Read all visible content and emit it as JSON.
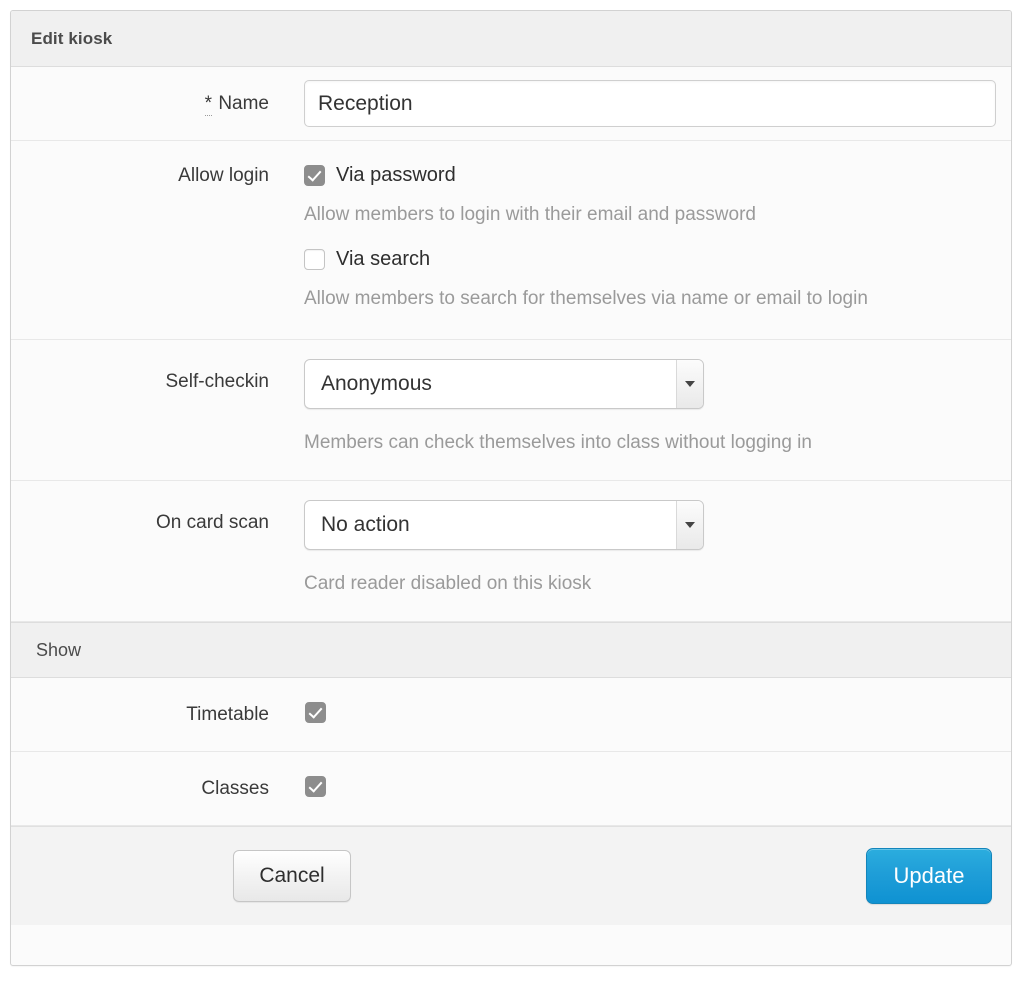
{
  "panel": {
    "title": "Edit kiosk"
  },
  "fields": {
    "name": {
      "required_marker": "*",
      "label": "Name",
      "value": "Reception",
      "placeholder": ""
    },
    "allow_login": {
      "label": "Allow login",
      "options": [
        {
          "label": "Via password",
          "checked": true,
          "help": "Allow members to login with their email and password"
        },
        {
          "label": "Via search",
          "checked": false,
          "help": "Allow members to search for themselves via name or email to login"
        }
      ]
    },
    "self_checkin": {
      "label": "Self-checkin",
      "value": "Anonymous",
      "help": "Members can check themselves into class without logging in"
    },
    "on_card_scan": {
      "label": "On card scan",
      "value": "No action",
      "help": "Card reader disabled on this kiosk"
    }
  },
  "show_section": {
    "title": "Show",
    "rows": [
      {
        "label": "Timetable",
        "checked": true
      },
      {
        "label": "Classes",
        "checked": true
      }
    ]
  },
  "footer": {
    "cancel_label": "Cancel",
    "update_label": "Update"
  },
  "colors": {
    "accent": "#1f9ed8",
    "panel_header_bg": "#f0f0f0",
    "checkbox_checked": "#8d8d8d",
    "help_text": "#9a9a9a"
  }
}
